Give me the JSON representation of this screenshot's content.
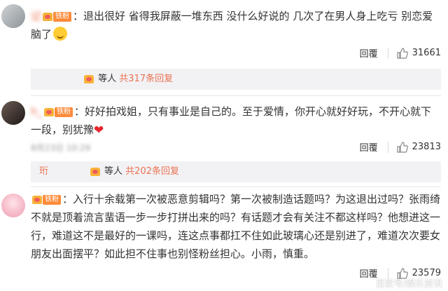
{
  "comments": [
    {
      "username": "记",
      "badge": "铁粉",
      "text": "：退出很好 省得我屏蔽一堆东西 没什么好说的 几次了在男人身上吃亏 别恋爱脑了",
      "reply_label": "回覆",
      "likes": "31661",
      "reply_summary": {
        "name": "",
        "suffix": "等人",
        "count": "共317条回复"
      }
    },
    {
      "username": "h_",
      "badge": "铁粉",
      "text": "：好好拍戏姐，只有事业是自己的。至于爱情，你开心就好好玩，不开心就下一段，别犹豫",
      "date": "8月23日 10:29",
      "reply_label": "回覆",
      "likes": "23813",
      "reply_summary": {
        "name": "珩",
        "suffix": "等人",
        "count": "共202条回复"
      }
    },
    {
      "username": "",
      "badge": "铁粉",
      "text": "：入行十余载第一次被恶意剪辑吗？第一次被制造话题吗？为这退出过吗？张雨绮不就是顶着流言蜚语一步一步打拼出来的吗？有话题才会有关注不都这样吗？他想进这一行，难道这不是最好的一课吗，连这点事都扛不住如此玻璃心还是别进了，难道次次要女朋友出面摆平？如此担不住事也别怪粉丝担心。小雨，慎重。",
      "reply_label": "回覆",
      "likes": "23579"
    }
  ],
  "watermark": "百家号/娱乐资讯",
  "colors": {
    "accent": "#eb7350",
    "badge": "#fd8b3b",
    "heart": "#e8262f"
  }
}
